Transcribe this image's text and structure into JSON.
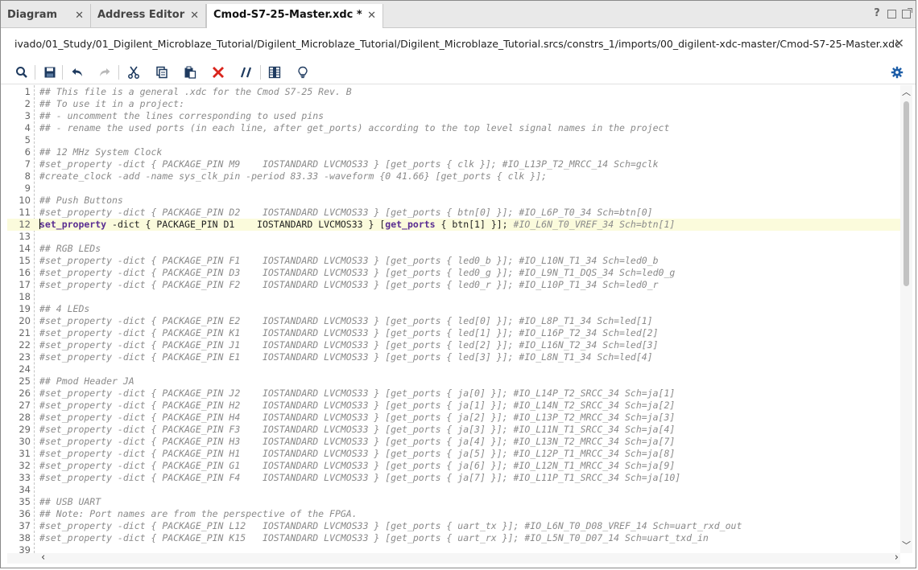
{
  "tabs": [
    {
      "label": "Diagram",
      "close": "✕"
    },
    {
      "label": "Address Editor",
      "close": "✕"
    },
    {
      "label": "Cmod-S7-25-Master.xdc *",
      "close": "✕"
    }
  ],
  "window_controls": {
    "help": "?"
  },
  "path": {
    "text": "ivado/01_Study/01_Digilent_Microblaze_Tutorial/Digilent_Microblaze_Tutorial/Digilent_Microblaze_Tutorial.srcs/constrs_1/imports/00_digilent-xdc-master/Cmod-S7-25-Master.xdc",
    "close": "✕"
  },
  "toolbar": {
    "icons": [
      "search-icon",
      "save-icon",
      "undo-icon",
      "redo-icon",
      "cut-icon",
      "copy-icon",
      "paste-icon",
      "delete-icon",
      "comment-toggle-icon",
      "column-select-icon",
      "lightbulb-icon"
    ],
    "settings": "gear-icon"
  },
  "editor": {
    "current_line": 12,
    "lines": [
      "## This file is a general .xdc for the Cmod S7-25 Rev. B",
      "## To use it in a project:",
      "## - uncomment the lines corresponding to used pins",
      "## - rename the used ports (in each line, after get_ports) according to the top level signal names in the project",
      "",
      "## 12 MHz System Clock",
      "#set_property -dict { PACKAGE_PIN M9    IOSTANDARD LVCMOS33 } [get_ports { clk }]; #IO_L13P_T2_MRCC_14 Sch=gclk",
      "#create_clock -add -name sys_clk_pin -period 83.33 -waveform {0 41.66} [get_ports { clk }];",
      "",
      "## Push Buttons",
      "#set_property -dict { PACKAGE_PIN D2    IOSTANDARD LVCMOS33 } [get_ports { btn[0] }]; #IO_L6P_T0_34 Sch=btn[0]",
      "set_property -dict { PACKAGE_PIN D1    IOSTANDARD LVCMOS33 } [get_ports { btn[1] }]; #IO_L6N_T0_VREF_34 Sch=btn[1]",
      "",
      "## RGB LEDs",
      "#set_property -dict { PACKAGE_PIN F1    IOSTANDARD LVCMOS33 } [get_ports { led0_b }]; #IO_L10N_T1_34 Sch=led0_b",
      "#set_property -dict { PACKAGE_PIN D3    IOSTANDARD LVCMOS33 } [get_ports { led0_g }]; #IO_L9N_T1_DQS_34 Sch=led0_g",
      "#set_property -dict { PACKAGE_PIN F2    IOSTANDARD LVCMOS33 } [get_ports { led0_r }]; #IO_L10P_T1_34 Sch=led0_r",
      "",
      "## 4 LEDs",
      "#set_property -dict { PACKAGE_PIN E2    IOSTANDARD LVCMOS33 } [get_ports { led[0] }]; #IO_L8P_T1_34 Sch=led[1]",
      "#set_property -dict { PACKAGE_PIN K1    IOSTANDARD LVCMOS33 } [get_ports { led[1] }]; #IO_L16P_T2_34 Sch=led[2]",
      "#set_property -dict { PACKAGE_PIN J1    IOSTANDARD LVCMOS33 } [get_ports { led[2] }]; #IO_L16N_T2_34 Sch=led[3]",
      "#set_property -dict { PACKAGE_PIN E1    IOSTANDARD LVCMOS33 } [get_ports { led[3] }]; #IO_L8N_T1_34 Sch=led[4]",
      "",
      "## Pmod Header JA",
      "#set_property -dict { PACKAGE_PIN J2    IOSTANDARD LVCMOS33 } [get_ports { ja[0] }]; #IO_L14P_T2_SRCC_34 Sch=ja[1]",
      "#set_property -dict { PACKAGE_PIN H2    IOSTANDARD LVCMOS33 } [get_ports { ja[1] }]; #IO_L14N_T2_SRCC_34 Sch=ja[2]",
      "#set_property -dict { PACKAGE_PIN H4    IOSTANDARD LVCMOS33 } [get_ports { ja[2] }]; #IO_L13P_T2_MRCC_34 Sch=ja[3]",
      "#set_property -dict { PACKAGE_PIN F3    IOSTANDARD LVCMOS33 } [get_ports { ja[3] }]; #IO_L11N_T1_SRCC_34 Sch=ja[4]",
      "#set_property -dict { PACKAGE_PIN H3    IOSTANDARD LVCMOS33 } [get_ports { ja[4] }]; #IO_L13N_T2_MRCC_34 Sch=ja[7]",
      "#set_property -dict { PACKAGE_PIN H1    IOSTANDARD LVCMOS33 } [get_ports { ja[5] }]; #IO_L12P_T1_MRCC_34 Sch=ja[8]",
      "#set_property -dict { PACKAGE_PIN G1    IOSTANDARD LVCMOS33 } [get_ports { ja[6] }]; #IO_L12N_T1_MRCC_34 Sch=ja[9]",
      "#set_property -dict { PACKAGE_PIN F4    IOSTANDARD LVCMOS33 } [get_ports { ja[7] }]; #IO_L11P_T1_SRCC_34 Sch=ja[10]",
      "",
      "## USB UART",
      "## Note: Port names are from the perspective of the FPGA.",
      "#set_property -dict { PACKAGE_PIN L12   IOSTANDARD LVCMOS33 } [get_ports { uart_tx }]; #IO_L6N_T0_D08_VREF_14 Sch=uart_rxd_out",
      "#set_property -dict { PACKAGE_PIN K15   IOSTANDARD LVCMOS33 } [get_ports { uart_rx }]; #IO_L5N_T0_D07_14 Sch=uart_txd_in",
      ""
    ]
  },
  "colors": {
    "keyword": "#5a2d91",
    "comment": "#8a8a8a",
    "current_line_bg": "#fbfbdc",
    "delete_icon": "#d9241c",
    "gear": "#1f5fa8"
  }
}
